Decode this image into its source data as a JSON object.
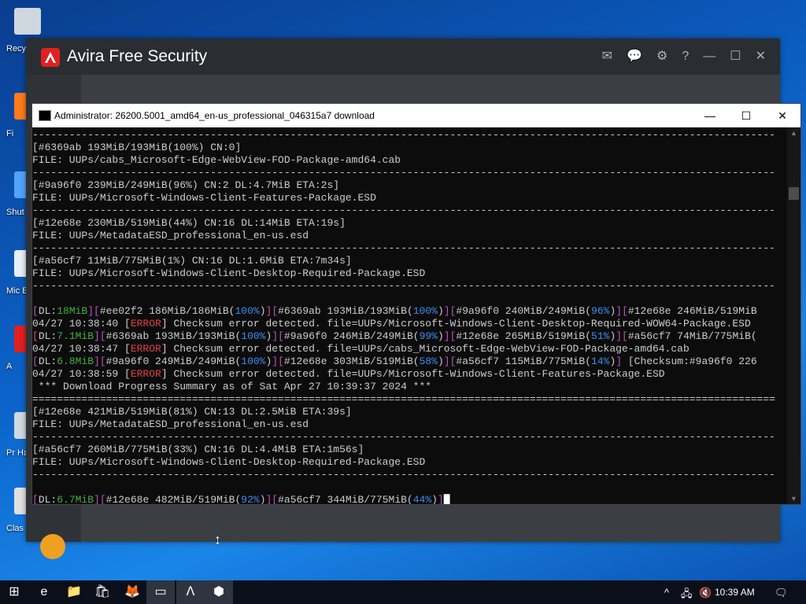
{
  "desktop": {
    "icons": [
      {
        "label": "Recy",
        "icon": "recycle-bin-icon"
      },
      {
        "label": "Fi",
        "icon": "firefox-icon"
      },
      {
        "label": "Shut",
        "icon": "shutdown-icon"
      },
      {
        "label": "Mic E",
        "icon": "edge-shortcut-icon"
      },
      {
        "label": "A",
        "icon": "avira-shortcut-icon"
      },
      {
        "label": "Pr Ha",
        "icon": "program-icon"
      },
      {
        "label": "Clas",
        "icon": "classic-shell-icon"
      }
    ]
  },
  "avira": {
    "brand": "Avira",
    "product": "Free Security",
    "header_icons": [
      "mail-icon",
      "chat-icon",
      "gear-icon",
      "help-icon",
      "minimize-icon",
      "maximize-icon",
      "close-icon"
    ],
    "header_glyphs": [
      "✉",
      "💬",
      "⚙",
      "?",
      "—",
      "☐",
      "✕"
    ]
  },
  "cmd": {
    "title": "Administrator:  26200.5001_amd64_en-us_professional_046315a7 download",
    "controls": {
      "minimize": "—",
      "maximize": "☐",
      "close": "✕"
    },
    "lines": [
      [
        {
          "t": "-------------------------------------------------------------------------------------------------------------------------",
          "c": ""
        }
      ],
      [
        {
          "t": "[#6369ab 193MiB/193MiB(100%) CN:0]",
          "c": ""
        }
      ],
      [
        {
          "t": "FILE: UUPs/cabs_Microsoft-Edge-WebView-FOD-Package-amd64.cab",
          "c": ""
        }
      ],
      [
        {
          "t": "-------------------------------------------------------------------------------------------------------------------------",
          "c": ""
        }
      ],
      [
        {
          "t": "[#9a96f0 239MiB/249MiB(96%) CN:2 DL:4.7MiB ETA:2s]",
          "c": ""
        }
      ],
      [
        {
          "t": "FILE: UUPs/Microsoft-Windows-Client-Features-Package.ESD",
          "c": ""
        }
      ],
      [
        {
          "t": "-------------------------------------------------------------------------------------------------------------------------",
          "c": ""
        }
      ],
      [
        {
          "t": "[#12e68e 230MiB/519MiB(44%) CN:16 DL:14MiB ETA:19s]",
          "c": ""
        }
      ],
      [
        {
          "t": "FILE: UUPs/MetadataESD_professional_en-us.esd",
          "c": ""
        }
      ],
      [
        {
          "t": "-------------------------------------------------------------------------------------------------------------------------",
          "c": ""
        }
      ],
      [
        {
          "t": "[#a56cf7 11MiB/775MiB(1%) CN:16 DL:1.6MiB ETA:7m34s]",
          "c": ""
        }
      ],
      [
        {
          "t": "FILE: UUPs/Microsoft-Windows-Client-Desktop-Required-Package.ESD",
          "c": ""
        }
      ],
      [
        {
          "t": "-------------------------------------------------------------------------------------------------------------------------",
          "c": ""
        }
      ],
      [
        {
          "t": "",
          "c": ""
        }
      ],
      [
        {
          "t": "[",
          "c": "m"
        },
        {
          "t": "DL:",
          "c": ""
        },
        {
          "t": "18MiB",
          "c": "g"
        },
        {
          "t": "][",
          "c": "m"
        },
        {
          "t": "#ee02f2 186MiB/186MiB(",
          "c": ""
        },
        {
          "t": "100%",
          "c": "b"
        },
        {
          "t": ")",
          "c": ""
        },
        {
          "t": "][",
          "c": "m"
        },
        {
          "t": "#6369ab 193MiB/193MiB(",
          "c": ""
        },
        {
          "t": "100%",
          "c": "b"
        },
        {
          "t": ")",
          "c": ""
        },
        {
          "t": "][",
          "c": "m"
        },
        {
          "t": "#9a96f0 240MiB/249MiB(",
          "c": ""
        },
        {
          "t": "96%",
          "c": "b"
        },
        {
          "t": ")",
          "c": ""
        },
        {
          "t": "][",
          "c": "m"
        },
        {
          "t": "#12e68e 246MiB/519MiB",
          "c": ""
        }
      ],
      [
        {
          "t": "04/27 10:38:40 [",
          "c": ""
        },
        {
          "t": "ERROR",
          "c": "r"
        },
        {
          "t": "] Checksum error detected. file=UUPs/Microsoft-Windows-Client-Desktop-Required-WOW64-Package.ESD",
          "c": ""
        }
      ],
      [
        {
          "t": "[",
          "c": "m"
        },
        {
          "t": "DL:",
          "c": ""
        },
        {
          "t": "7.1MiB",
          "c": "g"
        },
        {
          "t": "][",
          "c": "m"
        },
        {
          "t": "#6369ab 193MiB/193MiB(",
          "c": ""
        },
        {
          "t": "100%",
          "c": "b"
        },
        {
          "t": ")",
          "c": ""
        },
        {
          "t": "][",
          "c": "m"
        },
        {
          "t": "#9a96f0 246MiB/249MiB(",
          "c": ""
        },
        {
          "t": "99%",
          "c": "b"
        },
        {
          "t": ")",
          "c": ""
        },
        {
          "t": "][",
          "c": "m"
        },
        {
          "t": "#12e68e 265MiB/519MiB(",
          "c": ""
        },
        {
          "t": "51%",
          "c": "b"
        },
        {
          "t": ")",
          "c": ""
        },
        {
          "t": "][",
          "c": "m"
        },
        {
          "t": "#a56cf7 74MiB/775MiB(",
          "c": ""
        }
      ],
      [
        {
          "t": "04/27 10:38:47 [",
          "c": ""
        },
        {
          "t": "ERROR",
          "c": "r"
        },
        {
          "t": "] Checksum error detected. file=UUPs/cabs_Microsoft-Edge-WebView-FOD-Package-amd64.cab",
          "c": ""
        }
      ],
      [
        {
          "t": "[",
          "c": "m"
        },
        {
          "t": "DL:",
          "c": ""
        },
        {
          "t": "6.8MiB",
          "c": "g"
        },
        {
          "t": "][",
          "c": "m"
        },
        {
          "t": "#9a96f0 249MiB/249MiB(",
          "c": ""
        },
        {
          "t": "100%",
          "c": "b"
        },
        {
          "t": ")",
          "c": ""
        },
        {
          "t": "][",
          "c": "m"
        },
        {
          "t": "#12e68e 303MiB/519MiB(",
          "c": ""
        },
        {
          "t": "58%",
          "c": "b"
        },
        {
          "t": ")",
          "c": ""
        },
        {
          "t": "][",
          "c": "m"
        },
        {
          "t": "#a56cf7 115MiB/775MiB(",
          "c": ""
        },
        {
          "t": "14%",
          "c": "b"
        },
        {
          "t": ")",
          "c": ""
        },
        {
          "t": "] ",
          "c": "m"
        },
        {
          "t": "[Checksum:#9a96f0 226",
          "c": ""
        }
      ],
      [
        {
          "t": "04/27 10:38:59 [",
          "c": ""
        },
        {
          "t": "ERROR",
          "c": "r"
        },
        {
          "t": "] Checksum error detected. file=UUPs/Microsoft-Windows-Client-Features-Package.ESD",
          "c": ""
        }
      ],
      [
        {
          "t": " *** Download Progress Summary as of Sat Apr 27 10:39:37 2024 ***",
          "c": ""
        }
      ],
      [
        {
          "t": "=========================================================================================================================",
          "c": ""
        }
      ],
      [
        {
          "t": "[#12e68e 421MiB/519MiB(81%) CN:13 DL:2.5MiB ETA:39s]",
          "c": ""
        }
      ],
      [
        {
          "t": "FILE: UUPs/MetadataESD_professional_en-us.esd",
          "c": ""
        }
      ],
      [
        {
          "t": "-------------------------------------------------------------------------------------------------------------------------",
          "c": ""
        }
      ],
      [
        {
          "t": "[#a56cf7 260MiB/775MiB(33%) CN:16 DL:4.4MiB ETA:1m56s]",
          "c": ""
        }
      ],
      [
        {
          "t": "FILE: UUPs/Microsoft-Windows-Client-Desktop-Required-Package.ESD",
          "c": ""
        }
      ],
      [
        {
          "t": "-------------------------------------------------------------------------------------------------------------------------",
          "c": ""
        }
      ],
      [
        {
          "t": "",
          "c": ""
        }
      ],
      [
        {
          "t": "[",
          "c": "m"
        },
        {
          "t": "DL:",
          "c": ""
        },
        {
          "t": "6.7MiB",
          "c": "g"
        },
        {
          "t": "][",
          "c": "m"
        },
        {
          "t": "#12e68e 482MiB/519MiB(",
          "c": ""
        },
        {
          "t": "92%",
          "c": "b"
        },
        {
          "t": ")",
          "c": ""
        },
        {
          "t": "][",
          "c": "m"
        },
        {
          "t": "#a56cf7 344MiB/775MiB(",
          "c": ""
        },
        {
          "t": "44%",
          "c": "b"
        },
        {
          "t": ")",
          "c": ""
        },
        {
          "t": "]",
          "c": "m"
        },
        {
          "t": "█",
          "c": "w"
        }
      ]
    ]
  },
  "taskbar": {
    "items": [
      {
        "name": "start-button",
        "glyph": "⊞"
      },
      {
        "name": "edge-taskbar-icon",
        "glyph": "e"
      },
      {
        "name": "file-explorer-taskbar-icon",
        "glyph": "📁"
      },
      {
        "name": "store-taskbar-icon",
        "glyph": "🛍"
      },
      {
        "name": "firefox-taskbar-icon",
        "glyph": "🦊"
      },
      {
        "name": "cmd-taskbar-icon",
        "glyph": "▭"
      },
      {
        "name": "avira-taskbar-icon",
        "glyph": "ᐱ"
      },
      {
        "name": "app-taskbar-icon",
        "glyph": "⬢"
      }
    ],
    "tray": {
      "chevron": "^",
      "network": "🖧",
      "volume": "🔇",
      "time": "10:39 AM",
      "notifications": "🗨"
    }
  },
  "colors": {
    "magenta": "#c050c0",
    "green": "#40b040",
    "blue": "#3b8ff0",
    "red": "#e04040",
    "avira_red": "#e02020"
  }
}
